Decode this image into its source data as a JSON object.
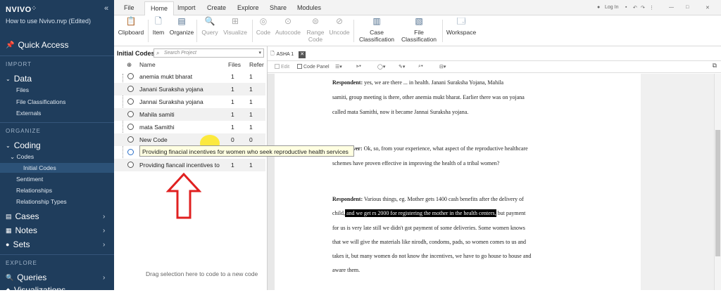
{
  "sidebar": {
    "brand": "NVIVO",
    "project": "How to use Nvivo.nvp (Edited)",
    "collapse_label": "«",
    "quick_access": "Quick Access",
    "import_head": "IMPORT",
    "data": "Data",
    "data_items": [
      "Files",
      "File Classifications",
      "Externals"
    ],
    "organize_head": "ORGANIZE",
    "coding": "Coding",
    "codes_node": "Codes",
    "initial_codes": "Initial Codes",
    "coding_items": [
      "Sentiment",
      "Relationships",
      "Relationship Types"
    ],
    "cases": "Cases",
    "notes": "Notes",
    "sets": "Sets",
    "explore_head": "EXPLORE",
    "queries": "Queries",
    "bottom_item": "Visualizations"
  },
  "menu": {
    "tabs": [
      "File",
      "Home",
      "Import",
      "Create",
      "Explore",
      "Share",
      "Modules"
    ],
    "active_tab": "Home",
    "login": "Log In"
  },
  "ribbon": {
    "clipboard": "Clipboard",
    "item": "Item",
    "organize": "Organize",
    "query": "Query",
    "visualize": "Visualize",
    "code": "Code",
    "autocode": "Autocode",
    "range_code_1": "Range",
    "range_code_2": "Code",
    "uncode": "Uncode",
    "case_class_1": "Case",
    "case_class_2": "Classification",
    "file_class_1": "File",
    "file_class_2": "Classification",
    "workspace": "Workspace"
  },
  "codes_panel": {
    "title": "Initial Codes",
    "search_placeholder": "Search Project",
    "columns": {
      "name": "Name",
      "files": "Files",
      "refs": "Refer"
    },
    "rows": [
      {
        "name": "anemia mukt bharat",
        "files": "1",
        "refs": "1"
      },
      {
        "name": "Janani Suraksha yojana",
        "files": "1",
        "refs": "1"
      },
      {
        "name": "Jannai Suraksha yojana",
        "files": "1",
        "refs": "1"
      },
      {
        "name": "Mahila samiti",
        "files": "1",
        "refs": "1"
      },
      {
        "name": "mata Samithi",
        "files": "1",
        "refs": "1"
      },
      {
        "name": "New Code",
        "files": "0",
        "refs": "0"
      },
      {
        "name": "",
        "files": "",
        "refs": ""
      },
      {
        "name": "Providing fiancail incentives to",
        "files": "1",
        "refs": "1"
      }
    ],
    "tooltip": "Providing  finacial incentives for women who seek reproductive health services",
    "drag_hint": "Drag selection here to code to a new code"
  },
  "document": {
    "tab": "ASHA 1",
    "toolbar": {
      "edit": "Edit",
      "code_panel": "Code Panel"
    },
    "p1": {
      "line1_label": "Respondent:",
      "line1": " yes, we are there ... in health. Janani Suraksha Yojana, Mahila",
      "line2": "samiti, group meeting is there, other anemia mukt bharat. Earlier there was on yojana",
      "line3": "called mata Samithi, now it became Jannai Suraksha yojana."
    },
    "p2": {
      "line1_label": "Interviewer:",
      "line1": " Ok, so, from your experience, what aspect of the reproductive healthcare",
      "line2": "schemes have proven effective in improving the health of a tribal women?"
    },
    "p3": {
      "line1_label": "Respondent:",
      "line1": " Various things, eg. Mother gets 1400 cash benefits after the delivery of",
      "line2_pre": "child,",
      "line2_hl": " and we get rs 2000 for registering the mother in the health centers,",
      "line2_post": " but payment",
      "line3": "for us is very late still we didn't got payment of some deliveries. Some women knows",
      "line4": "that we will give the materials like nirodh, condoms, pads, so women comes to us and",
      "line5": "takes it, but many women do not know the incentives, we have to go house to house and",
      "line6": "aware them."
    }
  },
  "colors": {
    "sidebar_bg": "#1f3d5c",
    "tooltip_bg": "#ffffe1",
    "arrow": "#e02020",
    "cursor_highlight": "#ffe600"
  }
}
